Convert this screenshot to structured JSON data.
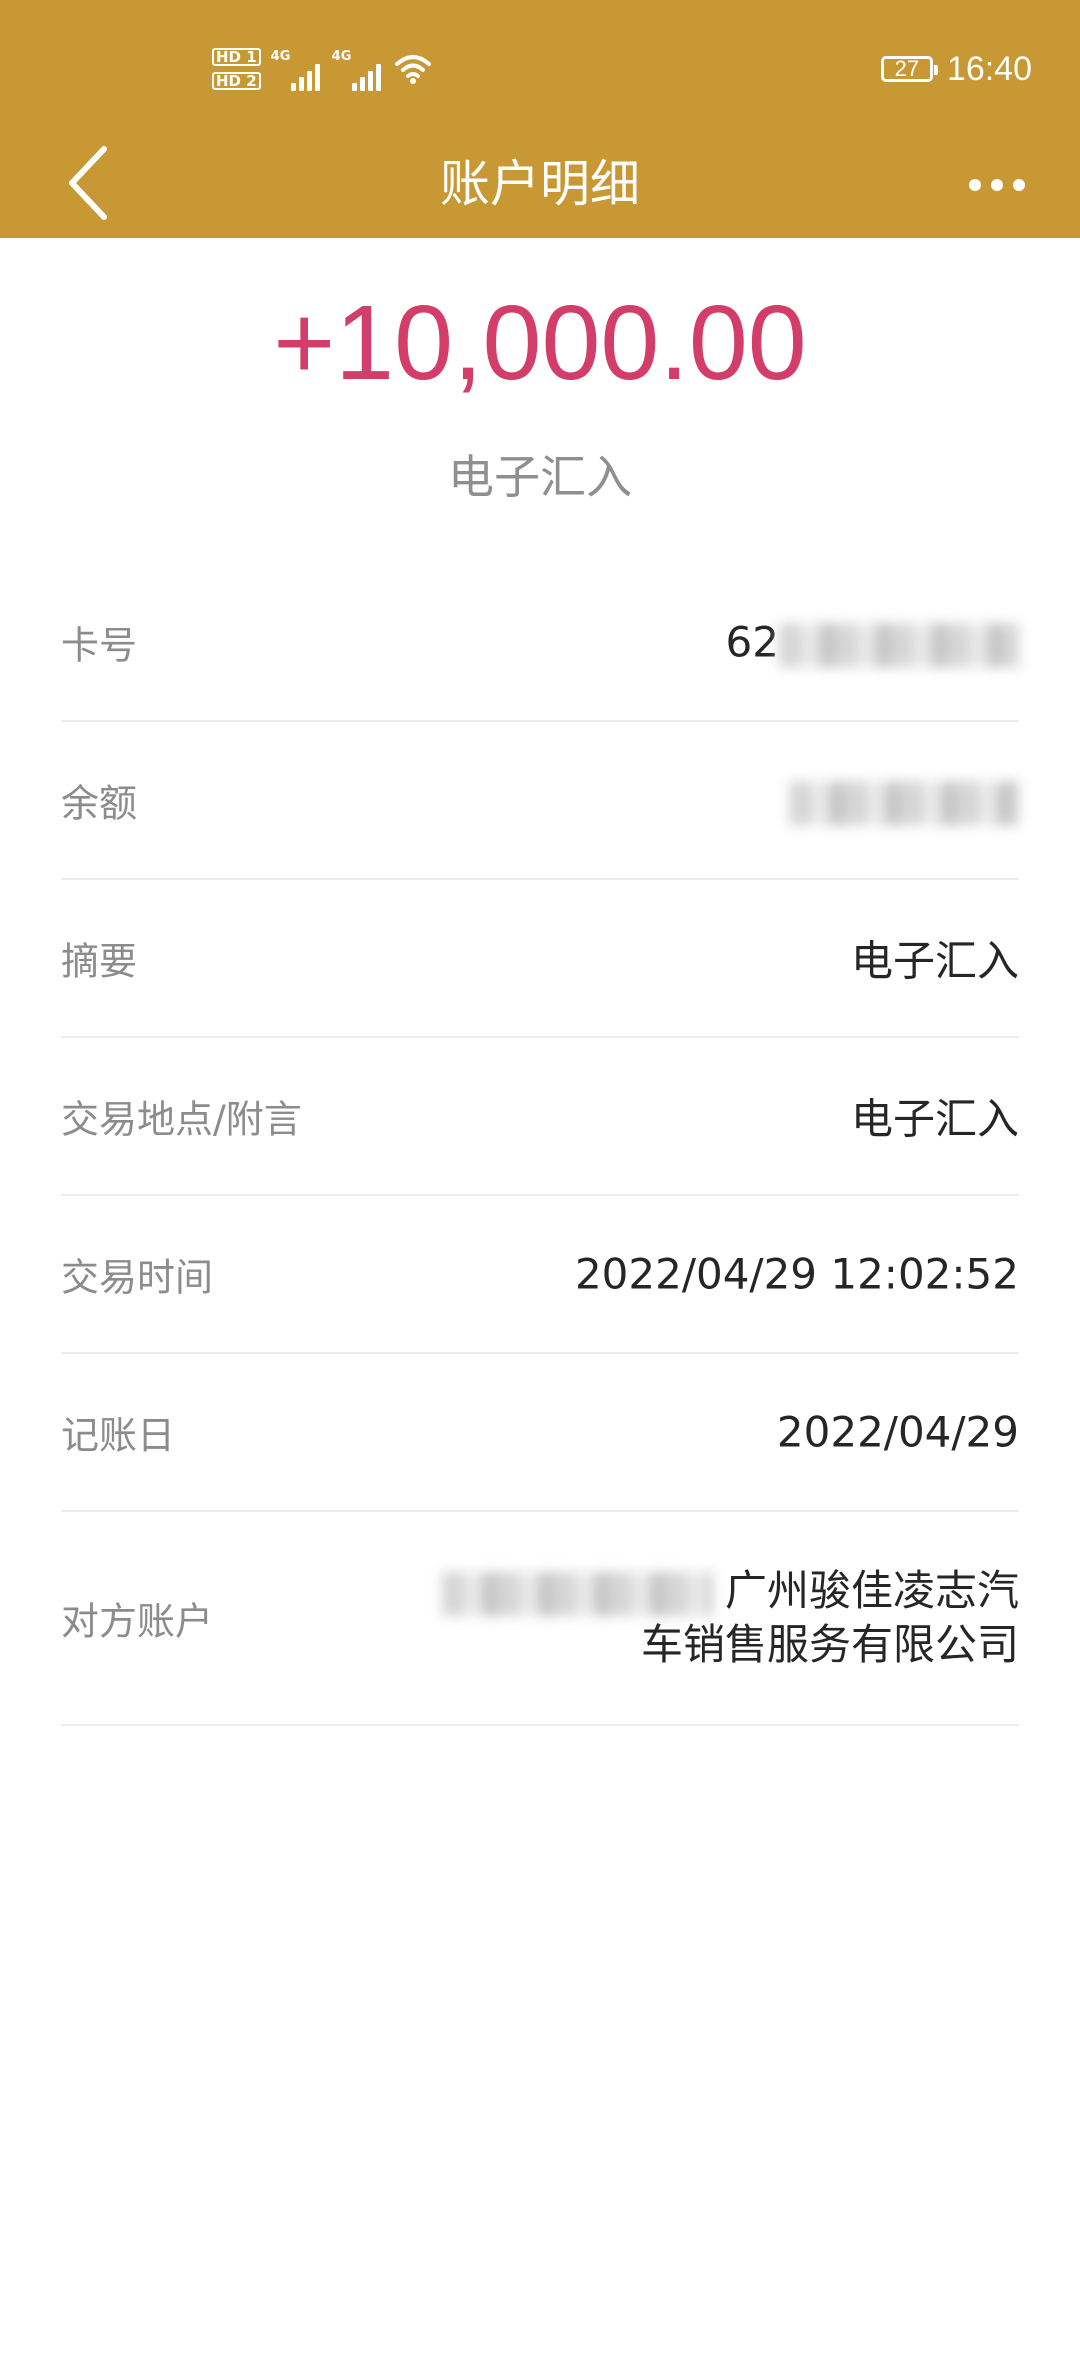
{
  "status_bar": {
    "hd1": "HD 1",
    "hd2": "HD 2",
    "network1": "4G",
    "network2": "4G",
    "battery": "27",
    "time": "16:40"
  },
  "nav": {
    "back_icon": "chevron-left-icon",
    "title": "账户明细",
    "more_icon": "more-horizontal-icon"
  },
  "transaction": {
    "amount": "+10,000.00",
    "type": "电子汇入"
  },
  "details": {
    "card_number": {
      "label": "卡号",
      "value": "62"
    },
    "balance": {
      "label": "余额",
      "value": ""
    },
    "summary": {
      "label": "摘要",
      "value": "电子汇入"
    },
    "location_note": {
      "label": "交易地点/附言",
      "value": "电子汇入"
    },
    "transaction_time": {
      "label": "交易时间",
      "value": "2022/04/29 12:02:52"
    },
    "posting_date": {
      "label": "记账日",
      "value": "2022/04/29"
    },
    "counterparty": {
      "label": "对方账户",
      "value": "广州骏佳凌志汽车销售服务有限公司"
    }
  },
  "colors": {
    "header_bg": "#c89834",
    "amount_color": "#d23d6a"
  }
}
